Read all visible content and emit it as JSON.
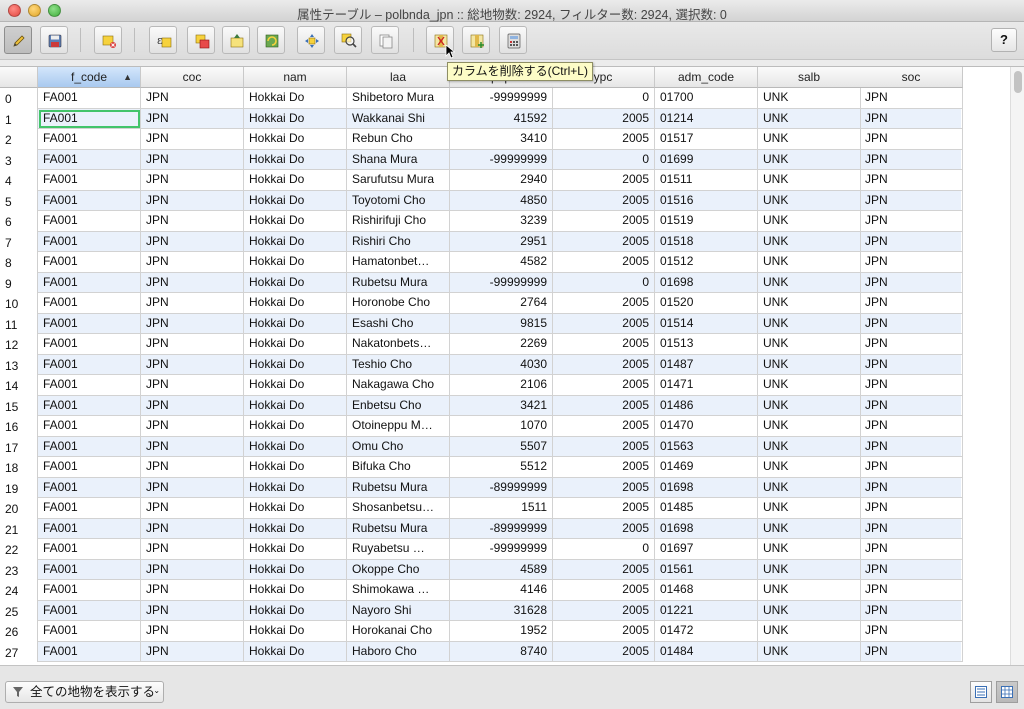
{
  "window": {
    "title": "属性テーブル – polbnda_jpn :: 総地物数: 2924, フィルター数: 2924, 選択数: 0"
  },
  "toolbar": {
    "buttons": [
      {
        "name": "toggle-editing-button",
        "icon": "pencil-icon",
        "active": true
      },
      {
        "name": "save-edits-button",
        "icon": "floppy-icon"
      },
      {
        "name": "delete-selected-button",
        "icon": "delete-selection-icon"
      },
      {
        "name": "select-by-expression-button",
        "icon": "expression-select-icon"
      },
      {
        "name": "deselect-all-button",
        "icon": "deselect-icon"
      },
      {
        "name": "move-selection-to-top-button",
        "icon": "selection-top-icon"
      },
      {
        "name": "invert-selection-button",
        "icon": "invert-selection-icon"
      },
      {
        "name": "pan-map-to-selection-button",
        "icon": "pan-selection-icon"
      },
      {
        "name": "zoom-map-to-selection-button",
        "icon": "zoom-selection-icon"
      },
      {
        "name": "copy-selected-rows-button",
        "icon": "copy-rows-icon"
      },
      {
        "name": "delete-column-button",
        "icon": "delete-column-icon"
      },
      {
        "name": "new-column-button",
        "icon": "new-column-icon"
      },
      {
        "name": "field-calculator-button",
        "icon": "calculator-icon"
      }
    ],
    "help_label": "?",
    "tooltip": "カラムを削除する(Ctrl+L)"
  },
  "table": {
    "columns": [
      "f_code",
      "coc",
      "nam",
      "laa",
      "pop",
      "ypc",
      "adm_code",
      "salb",
      "soc"
    ],
    "sorted_column": "f_code",
    "sort_indicator": "▲",
    "rows": [
      [
        "0",
        "FA001",
        "JPN",
        "Hokkai Do",
        "Shibetoro Mura",
        "-99999999",
        "0",
        "01700",
        "UNK",
        "JPN"
      ],
      [
        "1",
        "FA001",
        "JPN",
        "Hokkai Do",
        "Wakkanai Shi",
        "41592",
        "2005",
        "01214",
        "UNK",
        "JPN"
      ],
      [
        "2",
        "FA001",
        "JPN",
        "Hokkai Do",
        "Rebun Cho",
        "3410",
        "2005",
        "01517",
        "UNK",
        "JPN"
      ],
      [
        "3",
        "FA001",
        "JPN",
        "Hokkai Do",
        "Shana Mura",
        "-99999999",
        "0",
        "01699",
        "UNK",
        "JPN"
      ],
      [
        "4",
        "FA001",
        "JPN",
        "Hokkai Do",
        "Sarufutsu Mura",
        "2940",
        "2005",
        "01511",
        "UNK",
        "JPN"
      ],
      [
        "5",
        "FA001",
        "JPN",
        "Hokkai Do",
        "Toyotomi Cho",
        "4850",
        "2005",
        "01516",
        "UNK",
        "JPN"
      ],
      [
        "6",
        "FA001",
        "JPN",
        "Hokkai Do",
        "Rishirifuji Cho",
        "3239",
        "2005",
        "01519",
        "UNK",
        "JPN"
      ],
      [
        "7",
        "FA001",
        "JPN",
        "Hokkai Do",
        "Rishiri Cho",
        "2951",
        "2005",
        "01518",
        "UNK",
        "JPN"
      ],
      [
        "8",
        "FA001",
        "JPN",
        "Hokkai Do",
        "Hamatonbet…",
        "4582",
        "2005",
        "01512",
        "UNK",
        "JPN"
      ],
      [
        "9",
        "FA001",
        "JPN",
        "Hokkai Do",
        "Rubetsu Mura",
        "-99999999",
        "0",
        "01698",
        "UNK",
        "JPN"
      ],
      [
        "10",
        "FA001",
        "JPN",
        "Hokkai Do",
        "Horonobe Cho",
        "2764",
        "2005",
        "01520",
        "UNK",
        "JPN"
      ],
      [
        "11",
        "FA001",
        "JPN",
        "Hokkai Do",
        "Esashi Cho",
        "9815",
        "2005",
        "01514",
        "UNK",
        "JPN"
      ],
      [
        "12",
        "FA001",
        "JPN",
        "Hokkai Do",
        "Nakatonbets…",
        "2269",
        "2005",
        "01513",
        "UNK",
        "JPN"
      ],
      [
        "13",
        "FA001",
        "JPN",
        "Hokkai Do",
        "Teshio Cho",
        "4030",
        "2005",
        "01487",
        "UNK",
        "JPN"
      ],
      [
        "14",
        "FA001",
        "JPN",
        "Hokkai Do",
        "Nakagawa Cho",
        "2106",
        "2005",
        "01471",
        "UNK",
        "JPN"
      ],
      [
        "15",
        "FA001",
        "JPN",
        "Hokkai Do",
        "Enbetsu Cho",
        "3421",
        "2005",
        "01486",
        "UNK",
        "JPN"
      ],
      [
        "16",
        "FA001",
        "JPN",
        "Hokkai Do",
        "Otoineppu M…",
        "1070",
        "2005",
        "01470",
        "UNK",
        "JPN"
      ],
      [
        "17",
        "FA001",
        "JPN",
        "Hokkai Do",
        "Omu Cho",
        "5507",
        "2005",
        "01563",
        "UNK",
        "JPN"
      ],
      [
        "18",
        "FA001",
        "JPN",
        "Hokkai Do",
        "Bifuka Cho",
        "5512",
        "2005",
        "01469",
        "UNK",
        "JPN"
      ],
      [
        "19",
        "FA001",
        "JPN",
        "Hokkai Do",
        "Rubetsu Mura",
        "-89999999",
        "2005",
        "01698",
        "UNK",
        "JPN"
      ],
      [
        "20",
        "FA001",
        "JPN",
        "Hokkai Do",
        "Shosanbetsu…",
        "1511",
        "2005",
        "01485",
        "UNK",
        "JPN"
      ],
      [
        "21",
        "FA001",
        "JPN",
        "Hokkai Do",
        "Rubetsu Mura",
        "-89999999",
        "2005",
        "01698",
        "UNK",
        "JPN"
      ],
      [
        "22",
        "FA001",
        "JPN",
        "Hokkai Do",
        "Ruyabetsu …",
        "-99999999",
        "0",
        "01697",
        "UNK",
        "JPN"
      ],
      [
        "23",
        "FA001",
        "JPN",
        "Hokkai Do",
        "Okoppe Cho",
        "4589",
        "2005",
        "01561",
        "UNK",
        "JPN"
      ],
      [
        "24",
        "FA001",
        "JPN",
        "Hokkai Do",
        "Shimokawa …",
        "4146",
        "2005",
        "01468",
        "UNK",
        "JPN"
      ],
      [
        "25",
        "FA001",
        "JPN",
        "Hokkai Do",
        "Nayoro Shi",
        "31628",
        "2005",
        "01221",
        "UNK",
        "JPN"
      ],
      [
        "26",
        "FA001",
        "JPN",
        "Hokkai Do",
        "Horokanai Cho",
        "1952",
        "2005",
        "01472",
        "UNK",
        "JPN"
      ],
      [
        "27",
        "FA001",
        "JPN",
        "Hokkai Do",
        "Haboro Cho",
        "8740",
        "2005",
        "01484",
        "UNK",
        "JPN"
      ]
    ]
  },
  "footer": {
    "filter_label": "全ての地物を表示する",
    "dropdown_glyph": "⌄"
  },
  "colors": {
    "alt_row": "#eaf1fb",
    "sorted_header": "#b7d3f3",
    "focus_outline": "#43c46a",
    "tooltip_bg": "#fdfcc7"
  }
}
